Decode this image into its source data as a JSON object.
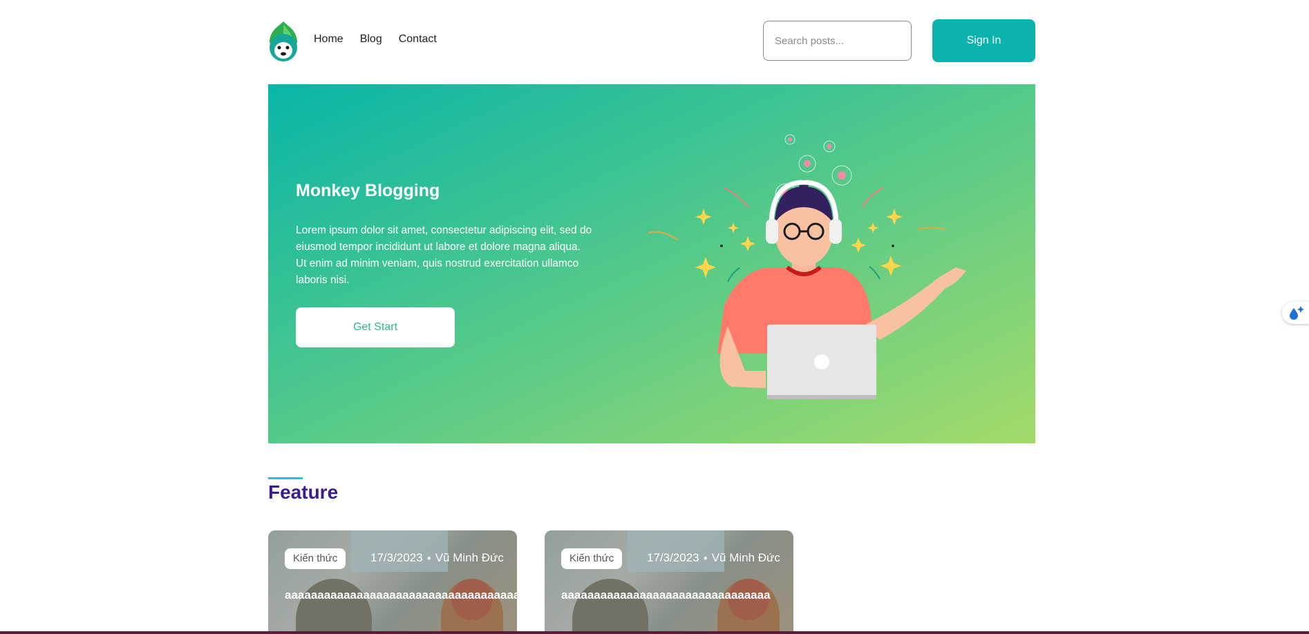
{
  "header": {
    "logo_icon": "monkey-logo-icon",
    "nav": [
      "Home",
      "Blog",
      "Contact"
    ],
    "search_placeholder": "Search posts...",
    "signin_label": "Sign In",
    "accent_color": "#0bb3ac"
  },
  "hero": {
    "title": "Monkey Blogging",
    "description": "Lorem ipsum dolor sit amet, consectetur adipiscing elit, sed do eiusmod tempor incididunt ut labore et dolore magna aliqua. Ut enim ad minim veniam, quis nostrud exercitation ullamco laboris nisi.",
    "button_label": "Get Start",
    "illustration_icon": "person-with-headphones-laptop-illustration"
  },
  "feature": {
    "title": "Feature",
    "cards": [
      {
        "category": "Kiến thức",
        "date": "17/3/2023",
        "author": "Vũ Minh Đức",
        "title": "aaaaaaaaaaaaaaaaaaaaaaaaaaaaaaaaaaaaaa"
      },
      {
        "category": "Kiến thức",
        "date": "17/3/2023",
        "author": "Vũ Minh Đức",
        "title": "aaaaaaaaaaaaaaaaaaaaaaaaaaaaaaaa"
      }
    ]
  },
  "floating_widget_icon": "sparkle-drop-icon"
}
